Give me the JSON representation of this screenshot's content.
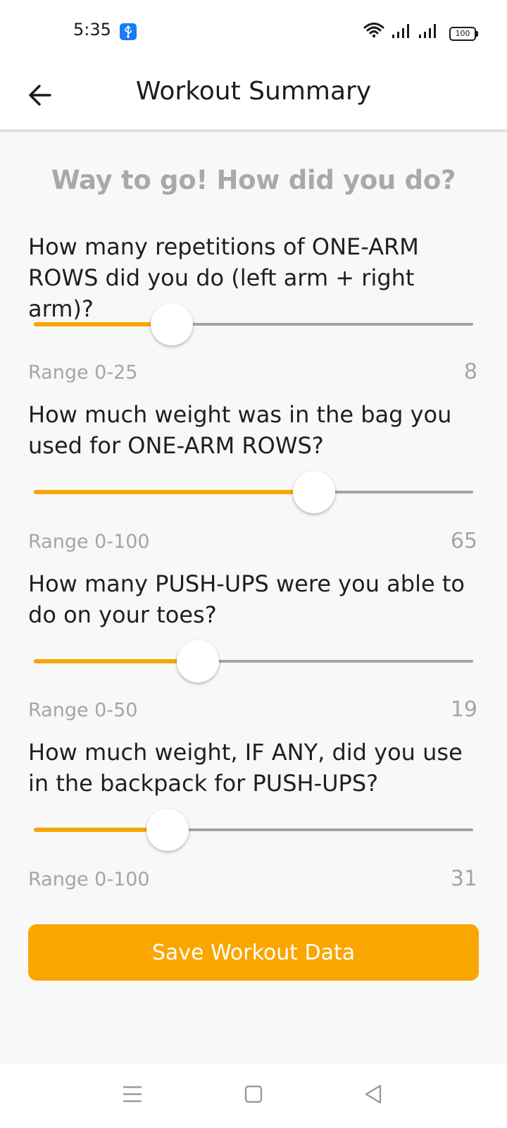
{
  "status": {
    "time": "5:35",
    "battery": "100",
    "usb_icon": "usb-icon",
    "wifi_icon": "wifi-icon",
    "signal_icon": "signal-icon"
  },
  "appbar": {
    "title": "Workout Summary",
    "back_icon": "arrow-left-icon"
  },
  "heading": "Way to go! How did you do?",
  "questions": [
    {
      "text": "How many repetitions of ONE-ARM ROWS did you do (left arm + right arm)?",
      "range_label": "Range 0-25",
      "min": 0,
      "max": 25,
      "value": 8
    },
    {
      "text": "How much weight was in the bag you used for ONE-ARM ROWS?",
      "range_label": "Range 0-100",
      "min": 0,
      "max": 100,
      "value": 65
    },
    {
      "text": "How many PUSH-UPS were you able to do on your toes?",
      "range_label": "Range 0-50",
      "min": 0,
      "max": 50,
      "value": 19
    },
    {
      "text": "How much weight, IF ANY, did you use in the backpack for PUSH-UPS?",
      "range_label": "Range 0-100",
      "min": 0,
      "max": 100,
      "value": 31
    }
  ],
  "save_button": {
    "label": "Save Workout Data"
  },
  "colors": {
    "accent": "#f9a600",
    "track": "#a3a3a3",
    "muted_text": "#a5a5a5"
  },
  "navbar": {
    "icons": [
      "menu-icon",
      "home-square-icon",
      "back-triangle-icon"
    ]
  }
}
